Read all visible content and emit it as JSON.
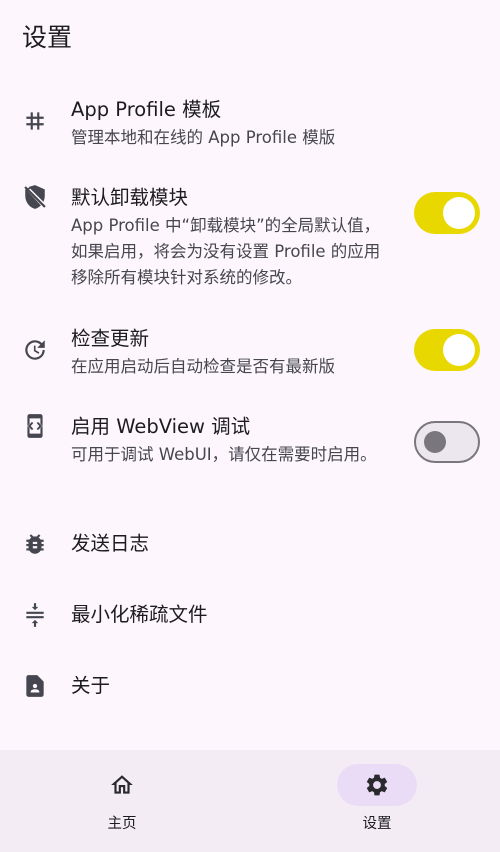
{
  "header": {
    "title": "设置"
  },
  "settings": [
    {
      "icon": "grid-icon",
      "headline": "App Profile 模板",
      "support": "管理本地和在线的 App Profile 模版"
    },
    {
      "icon": "shield-off-icon",
      "headline": "默认卸载模块",
      "support": "App Profile 中“卸载模块”的全局默认值，如果启用，将会为没有设置 Profile 的应用移除所有模块针对系统的修改。",
      "switch": "on"
    },
    {
      "icon": "update-icon",
      "headline": "检查更新",
      "support": "在应用启动后自动检查是否有最新版",
      "switch": "on"
    },
    {
      "icon": "webview-code-icon",
      "headline": "启用 WebView 调试",
      "support": "可用于调试 WebUI，请仅在需要时启用。",
      "switch": "off"
    },
    {
      "icon": "bug-icon",
      "headline": "发送日志"
    },
    {
      "icon": "compress-icon",
      "headline": "最小化稀疏文件"
    },
    {
      "icon": "contact-page-icon",
      "headline": "关于"
    }
  ],
  "nav": {
    "items": [
      {
        "label": "主页",
        "icon": "home-icon",
        "active": false
      },
      {
        "label": "设置",
        "icon": "gear-icon",
        "active": true
      }
    ]
  },
  "colors": {
    "accent": "#e8d800",
    "background": "#fdf7fd",
    "navbar": "#f3ecf4",
    "active_pill": "#eadcf7"
  }
}
